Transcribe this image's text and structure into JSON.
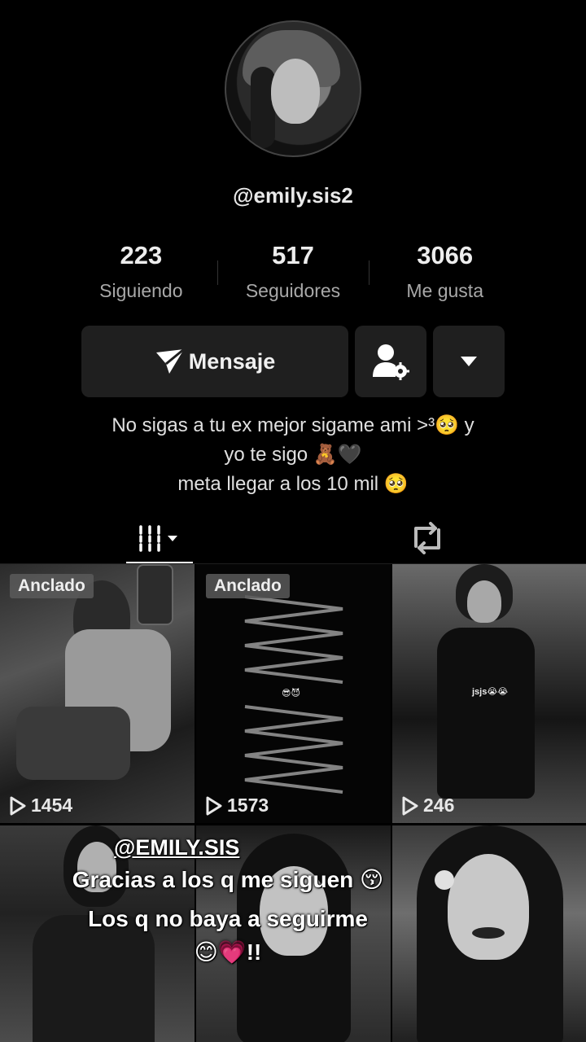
{
  "profile": {
    "username": "@emily.sis2"
  },
  "stats": [
    {
      "value": "223",
      "label": "Siguiendo"
    },
    {
      "value": "517",
      "label": "Seguidores"
    },
    {
      "value": "3066",
      "label": "Me gusta"
    }
  ],
  "actions": {
    "message_label": "Mensaje"
  },
  "bio": {
    "line1": "No sigas a tu ex mejor sigame ami >³🥺 y",
    "line2": "yo te sigo 🧸🖤",
    "line3": "meta llegar a los 10 mil 🥺"
  },
  "videos": [
    {
      "pinned_label": "Anclado",
      "views": "1454"
    },
    {
      "pinned_label": "Anclado",
      "views": "1573",
      "caption": "😎😈"
    },
    {
      "views": "246",
      "caption": "jsjs😭😭"
    },
    {
      "overlay_handle": "@EMILY.SIS",
      "overlay_line1": "Gracias a los q me siguen 😚",
      "overlay_line2": "Los q no baya a seguirme",
      "overlay_line3": "😊💗!!"
    },
    {},
    {}
  ]
}
